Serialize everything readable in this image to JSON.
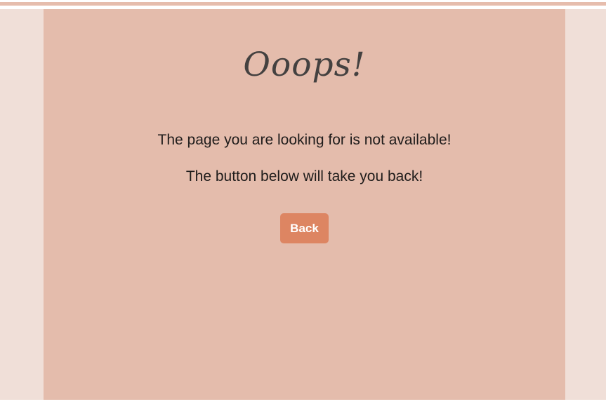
{
  "page": {
    "title": "Ooops!",
    "message": "The page you are looking for is not available!",
    "hint": "The button below will take you back!"
  },
  "actions": {
    "back_label": "Back"
  },
  "colors": {
    "outer_background": "#f0dfd8",
    "panel_background": "#e4bcac",
    "accent": "#dd8562",
    "title_text": "#444140",
    "body_text": "#1f1c1b"
  }
}
